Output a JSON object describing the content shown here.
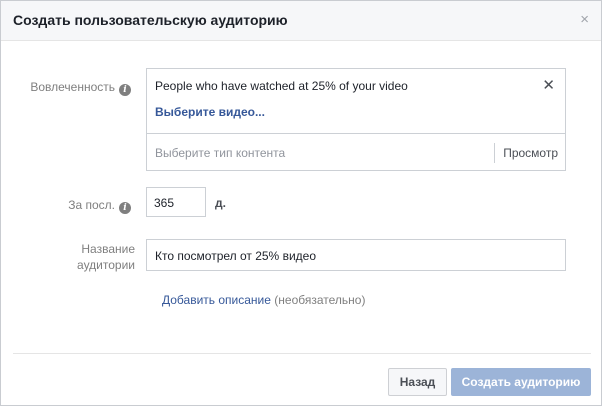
{
  "dialog": {
    "title": "Создать пользовательскую аудиторию",
    "close_glyph": "×"
  },
  "engagement": {
    "label": "Вовлеченность",
    "info_glyph": "i",
    "selected_rule": "People who have watched at 25% of your video",
    "remove_glyph": "✕",
    "select_video_link": "Выберите видео...",
    "content_type_placeholder": "Выберите тип контента",
    "preview_button": "Просмотр"
  },
  "retention": {
    "label": "За посл.",
    "info_glyph": "i",
    "days_value": "365",
    "unit": "д."
  },
  "audience_name": {
    "label_line1": "Название",
    "label_line2": "аудитории",
    "value": "Кто посмотрел от 25% видео"
  },
  "description": {
    "link": "Добавить описание",
    "optional": "(необязательно)"
  },
  "footer": {
    "back_button": "Назад",
    "create_button": "Создать аудиторию"
  },
  "colors": {
    "link": "#365899",
    "primary_disabled": "#9cb4d8",
    "header_bg": "#f6f7f9",
    "border": "#ccd0d5"
  },
  "icons": [
    "close-icon",
    "info-icon",
    "remove-icon"
  ]
}
